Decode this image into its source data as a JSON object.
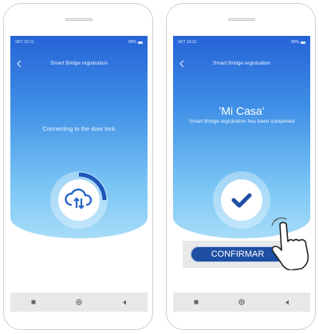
{
  "screens": [
    {
      "status_left": "SKT 10:21",
      "status_right": "89%",
      "header_title": "Smart Bridge registration",
      "message": "Connecting to the door lock",
      "progress_fraction": 0.25,
      "icon": "cloud-sync-icon"
    },
    {
      "status_left": "SKT 10:21",
      "status_right": "89%",
      "header_title": "Smart Bridge registration",
      "name": "'Mi Casa'",
      "message": "Smart Bridge registration has been completed",
      "button_label": "CONFIRMAR",
      "icon": "checkmark-icon"
    }
  ],
  "navbar": {
    "icons": [
      "recent-apps-icon",
      "home-icon",
      "back-icon"
    ]
  },
  "colors": {
    "primary": "#2563d6",
    "button": "#1f4fa3",
    "gradient_bottom": "#a7dcf8"
  }
}
